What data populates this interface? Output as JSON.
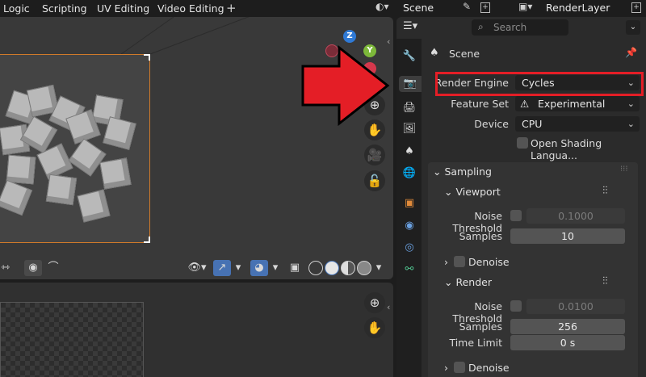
{
  "topbar": {
    "workspace_tabs": [
      "Logic",
      "Scripting",
      "UV Editing",
      "Video Editing"
    ],
    "add_workspace": "+",
    "scene_label": "Scene",
    "render_layer_label": "RenderLayer"
  },
  "viewport": {
    "gizmo": {
      "z": "Z",
      "y": "Y"
    },
    "footer_proportional_icon": "⌒"
  },
  "properties": {
    "search_placeholder": "Search",
    "scene_name": "Scene",
    "render_engine": {
      "label": "Render Engine",
      "value": "Cycles"
    },
    "feature_set": {
      "label": "Feature Set",
      "value": "Experimental"
    },
    "device": {
      "label": "Device",
      "value": "CPU"
    },
    "osl": {
      "label": "Open Shading Langua..."
    },
    "sampling": {
      "title": "Sampling",
      "viewport": {
        "title": "Viewport",
        "noise_threshold_label": "Noise Threshold",
        "noise_threshold_value": "0.1000",
        "samples_label": "Samples",
        "samples_value": "10",
        "denoise_label": "Denoise"
      },
      "render": {
        "title": "Render",
        "noise_threshold_label": "Noise Threshold",
        "noise_threshold_value": "0.0100",
        "samples_label": "Samples",
        "samples_value": "256",
        "time_limit_label": "Time Limit",
        "time_limit_value": "0 s",
        "denoise_label": "Denoise"
      }
    }
  },
  "colors": {
    "annotation_red": "#e41e26",
    "axis_z": "#2f7ad6",
    "axis_y": "#7db83a",
    "axis_x": "#d5384c"
  }
}
